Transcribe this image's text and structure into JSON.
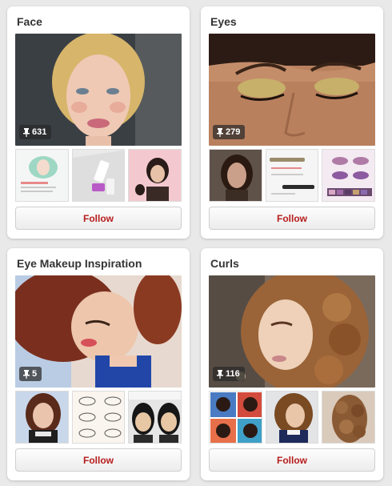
{
  "boards": [
    {
      "title": "Face",
      "pin_count": "631",
      "follow_label": "Follow"
    },
    {
      "title": "Eyes",
      "pin_count": "279",
      "follow_label": "Follow"
    },
    {
      "title": "Eye Makeup Inspiration",
      "pin_count": "5",
      "follow_label": "Follow"
    },
    {
      "title": "Curls",
      "pin_count": "116",
      "follow_label": "Follow"
    }
  ],
  "colors": {
    "page_background": "#e9e9e9",
    "card_background": "#ffffff",
    "follow_text": "#b71c1c",
    "title_text": "#333333"
  },
  "icons": {
    "pin_badge": "pushpin-icon"
  }
}
